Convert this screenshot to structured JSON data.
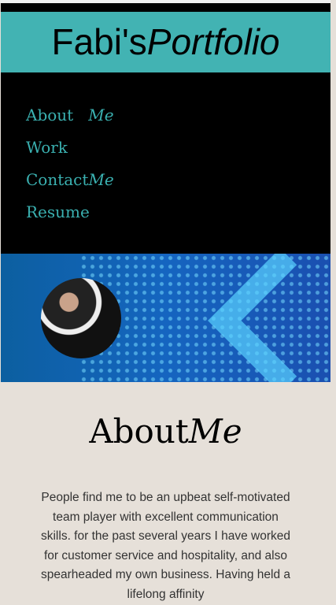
{
  "header": {
    "title_plain": "Fabi's",
    "title_italic": "Portfolio"
  },
  "nav": [
    {
      "plain": "About",
      "italic": "Me",
      "gap": true
    },
    {
      "plain": "Work",
      "italic": ""
    },
    {
      "plain": "Contact",
      "italic": "Me"
    },
    {
      "plain": "Resume",
      "italic": ""
    }
  ],
  "about": {
    "heading_plain": "About",
    "heading_italic": "Me",
    "body": "People find me to be an upbeat self-motivated team player with excellent communication skills. for the past several years I have worked for customer service and hospitality, and also spearheaded my own business. Having held a lifelong affinity"
  }
}
